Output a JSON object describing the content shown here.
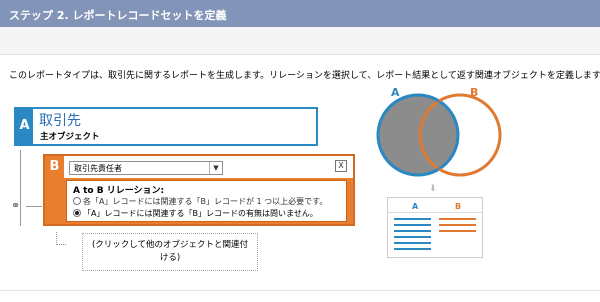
{
  "header": {
    "title": "ステップ 2. レポートレコードセットを定義"
  },
  "description": "このレポートタイプは、取引先に関するレポートを生成します。リレーションを選択して、レポート結果として返す関連オブジェクトを定義します。",
  "object_a": {
    "tag": "A",
    "title": "取引先",
    "subtitle": "主オブジェクト"
  },
  "object_b": {
    "tag": "B",
    "select_value": "取引先責任者",
    "close_label": "X",
    "relation_label": "A to B リレーション:",
    "options": [
      {
        "text": "各「A」レコードには関連する「B」レコードが 1 つ以上必要です。",
        "checked": false
      },
      {
        "text": "「A」レコードには関連する「B」レコードの有無は問いません。",
        "checked": true
      }
    ]
  },
  "add_related": {
    "label": "(クリックして他のオブジェクトと関連付ける)"
  },
  "venn": {
    "label_a": "A",
    "label_b": "B",
    "color_a": "#2a88c2",
    "color_b": "#e07a33",
    "overlap_fill": "#8c8c8c"
  },
  "result_table": {
    "header_a": "A",
    "header_b": "B",
    "rows": 6
  },
  "icons": {
    "link": "link-icon",
    "arrow": "down-arrow-icon",
    "dropdown": "chevron-down-icon",
    "close": "close-icon"
  }
}
